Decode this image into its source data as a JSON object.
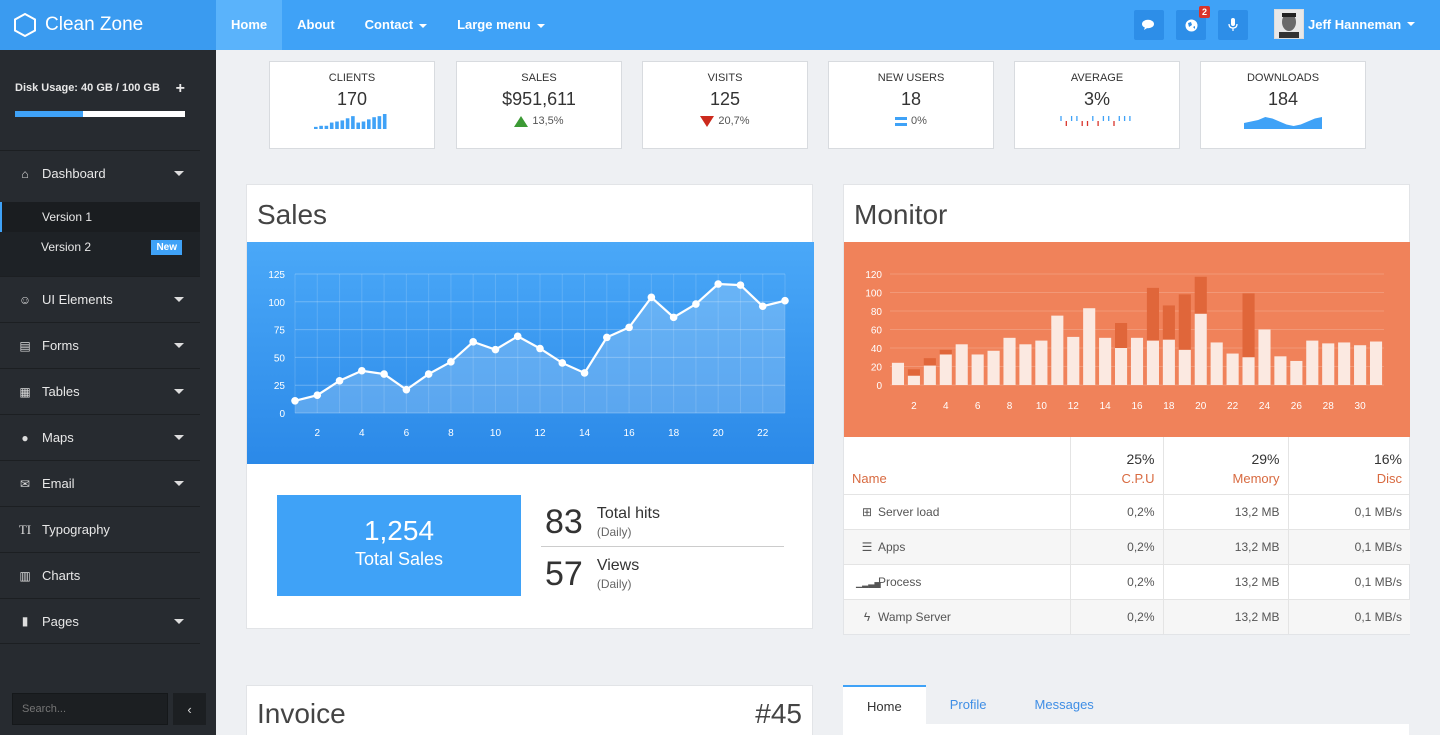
{
  "brand": {
    "name": "Clean Zone"
  },
  "topnav": {
    "items": [
      {
        "label": "Home",
        "active": true
      },
      {
        "label": "About"
      },
      {
        "label": "Contact",
        "dropdown": true
      },
      {
        "label": "Large menu",
        "dropdown": true
      }
    ],
    "notifications_badge": "2",
    "user_name": "Jeff Hanneman"
  },
  "sidebar": {
    "disk_label": "Disk Usage: 40 GB / 100 GB",
    "disk_fraction": 0.4,
    "plus": "+",
    "menu": [
      {
        "label": "Dashboard",
        "icon": "home-icon",
        "glyph": "⌂",
        "caret": true
      },
      {
        "label": "UI Elements",
        "icon": "smile-icon",
        "glyph": "☺",
        "caret": true
      },
      {
        "label": "Forms",
        "icon": "list-alt-icon",
        "glyph": "▤",
        "caret": true
      },
      {
        "label": "Tables",
        "icon": "table-icon",
        "glyph": "▦",
        "caret": true
      },
      {
        "label": "Maps",
        "icon": "map-marker-icon",
        "glyph": "●",
        "caret": true
      },
      {
        "label": "Email",
        "icon": "envelope-icon",
        "glyph": "✉",
        "caret": true
      },
      {
        "label": "Typography",
        "icon": "text-height-icon",
        "glyph": "TI",
        "caret": false
      },
      {
        "label": "Charts",
        "icon": "bar-chart-icon",
        "glyph": "▥",
        "caret": false
      },
      {
        "label": "Pages",
        "icon": "file-icon",
        "glyph": "▮",
        "caret": true
      }
    ],
    "submenu": [
      {
        "label": "Version 1",
        "active": true
      },
      {
        "label": "Version 2",
        "badge": "New"
      }
    ],
    "search_placeholder": "Search...",
    "collapse_glyph": "‹"
  },
  "stats": [
    {
      "label": "CLIENTS",
      "value": "170",
      "spark": "bars",
      "spark_values": [
        2,
        3,
        3,
        6,
        7,
        8,
        10,
        12,
        6,
        7,
        9,
        11,
        12,
        14
      ]
    },
    {
      "label": "SALES",
      "value": "$951,611",
      "trend": "up",
      "change": "13,5%"
    },
    {
      "label": "VISITS",
      "value": "125",
      "trend": "down",
      "change": "20,7%"
    },
    {
      "label": "NEW USERS",
      "value": "18",
      "trend": "flat",
      "change": "0%"
    },
    {
      "label": "AVERAGE",
      "value": "3%",
      "spark": "ticks",
      "spark_values": [
        1,
        -1,
        1,
        1,
        -1,
        -1,
        1,
        -1,
        1,
        1,
        -1,
        1,
        1,
        1
      ]
    },
    {
      "label": "DOWNLOADS",
      "value": "184",
      "spark": "area",
      "spark_values": [
        4,
        5,
        6,
        8,
        7,
        5,
        3,
        2,
        3,
        5,
        7,
        8
      ]
    }
  ],
  "sales_panel": {
    "title": "Sales",
    "total_value": "1,254",
    "total_label": "Total Sales",
    "hits_value": "83",
    "hits_label": "Total hits",
    "hits_period": "(Daily)",
    "views_value": "57",
    "views_label": "Views",
    "views_period": "(Daily)"
  },
  "monitor_panel": {
    "title": "Monitor",
    "headers": [
      {
        "label": "Name",
        "pct": ""
      },
      {
        "label": "C.P.U",
        "pct": "25%"
      },
      {
        "label": "Memory",
        "pct": "29%"
      },
      {
        "label": "Disc",
        "pct": "16%"
      }
    ],
    "rows": [
      {
        "icon": "sitemap-icon",
        "glyph": "⊞",
        "name": "Server load",
        "cpu": "0,2%",
        "mem": "13,2 MB",
        "disc": "0,1 MB/s"
      },
      {
        "icon": "server-icon",
        "glyph": "☰",
        "name": "Apps",
        "cpu": "0,2%",
        "mem": "13,2 MB",
        "disc": "0,1 MB/s"
      },
      {
        "icon": "signal-icon",
        "glyph": "▁▂▃▅",
        "name": "Process",
        "cpu": "0,2%",
        "mem": "13,2 MB",
        "disc": "0,1 MB/s"
      },
      {
        "icon": "bolt-icon",
        "glyph": "ϟ",
        "name": "Wamp Server",
        "cpu": "0,2%",
        "mem": "13,2 MB",
        "disc": "0,1 MB/s"
      }
    ]
  },
  "invoice_panel": {
    "title": "Invoice",
    "number": "#45"
  },
  "tabs": [
    {
      "label": "Home",
      "active": true
    },
    {
      "label": "Profile"
    },
    {
      "label": "Messages"
    }
  ],
  "colors": {
    "accent": "#3fa2f7",
    "sidebar": "#272b30",
    "monitor": "#f0825a"
  },
  "chart_data": [
    {
      "type": "line",
      "x": [
        1,
        2,
        3,
        4,
        5,
        6,
        7,
        8,
        9,
        10,
        11,
        12,
        13,
        14,
        15,
        16,
        17,
        18,
        19,
        20,
        21,
        22,
        23
      ],
      "xticks": [
        2,
        4,
        6,
        8,
        10,
        12,
        14,
        16,
        18,
        20,
        22
      ],
      "yticks": [
        0,
        25,
        50,
        75,
        100,
        125
      ],
      "series": [
        {
          "values": [
            11,
            16,
            29,
            38,
            35,
            21,
            35,
            46,
            64,
            57,
            69,
            58,
            45,
            36,
            68,
            77,
            104,
            86,
            98,
            116,
            115,
            96,
            101
          ]
        }
      ],
      "ylim": [
        0,
        125
      ],
      "grid": true
    },
    {
      "type": "bar",
      "x": [
        1,
        2,
        3,
        4,
        5,
        6,
        7,
        8,
        9,
        10,
        11,
        12,
        13,
        14,
        15,
        16,
        17,
        18,
        19,
        20,
        21,
        22,
        23,
        24,
        25,
        26,
        27,
        28,
        29,
        30,
        31
      ],
      "xticks": [
        2,
        4,
        6,
        8,
        10,
        12,
        14,
        16,
        18,
        20,
        22,
        24,
        26,
        28,
        30
      ],
      "yticks": [
        0,
        20,
        40,
        60,
        80,
        100,
        120
      ],
      "series": [
        {
          "values": [
            24,
            10,
            21,
            33,
            44,
            33,
            37,
            51,
            44,
            48,
            75,
            52,
            83,
            51,
            40,
            51,
            48,
            49,
            38,
            77,
            46,
            34,
            30,
            60,
            31,
            26,
            48,
            45,
            46,
            43,
            47
          ]
        },
        {
          "values": [
            0,
            17,
            29,
            38,
            0,
            0,
            0,
            0,
            0,
            0,
            64,
            0,
            0,
            0,
            67,
            0,
            105,
            86,
            98,
            117,
            0,
            0,
            99,
            0,
            0,
            0,
            0,
            0,
            0,
            0,
            0
          ]
        }
      ],
      "ylim": [
        0,
        120
      ],
      "grid": true
    }
  ]
}
